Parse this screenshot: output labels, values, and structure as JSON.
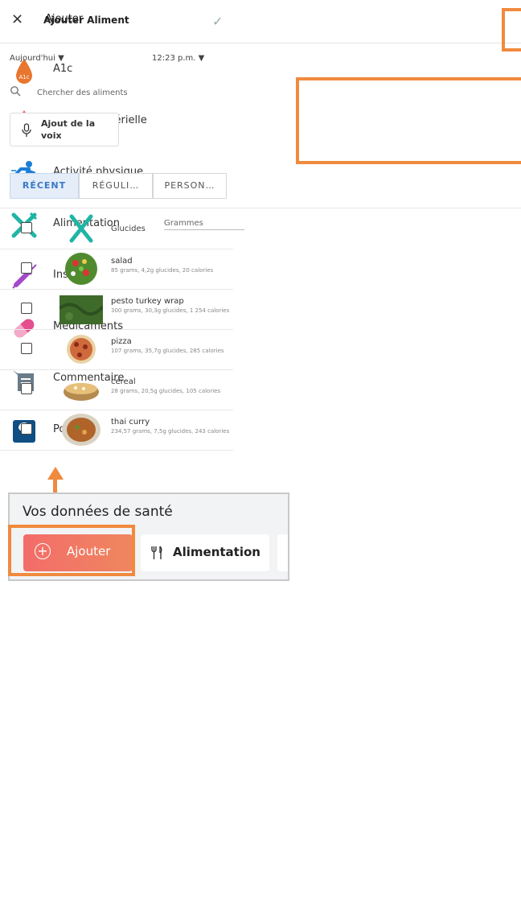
{
  "add_menu": {
    "title": "Ajouter",
    "close_icon": "×",
    "items": [
      {
        "label": "A1c",
        "icon": "a1c-drop-icon"
      },
      {
        "label": "Pression artérielle",
        "icon": "blood-pressure-drop-icon"
      },
      {
        "label": "Activité physique",
        "icon": "runner-icon"
      },
      {
        "label": "Alimentation",
        "icon": "fork-knife-icon"
      },
      {
        "label": "Insuline",
        "icon": "syringe-icon"
      },
      {
        "label": "Médicaments",
        "icon": "pill-icon"
      },
      {
        "label": "Commentaire",
        "icon": "comment-icon"
      },
      {
        "label": "Poids",
        "icon": "scale-icon"
      }
    ],
    "a1c_badge": "A1c"
  },
  "add_food": {
    "title": "Ajouter Aliment",
    "close_icon": "×",
    "confirm_icon": "✓",
    "date": "Aujourd'hui ▼",
    "time": "12:23 p.m. ▼",
    "search_placeholder": "Chercher des aliments",
    "voice_label": "Ajout de la voix",
    "tabs": [
      "RÉCENT",
      "RÉGULI…",
      "PERSON…"
    ],
    "carbs_label": "Glucides",
    "carbs_unit": "Grammes",
    "foods": [
      {
        "name": "salad",
        "detail": "85 grams, 4,2g glucides, 20 calories"
      },
      {
        "name": "pesto turkey wrap",
        "detail": "300 grams, 30,3g glucides, 1 254 calories"
      },
      {
        "name": "pizza",
        "detail": "107 grams, 35,7g glucides, 285 calories"
      },
      {
        "name": "cereal",
        "detail": "28 grams, 20,5g glucides, 105 calories"
      },
      {
        "name": "thai curry",
        "detail": "234,57 grams, 7,5g glucides, 243 calories"
      }
    ]
  },
  "health": {
    "title": "Vos données de santé",
    "add_label": "Ajouter",
    "add_icon": "+",
    "food_label": "Alimentation",
    "food_icon": "🍴"
  },
  "colors": {
    "highlight": "#f08a3e",
    "accent": "#3a78c8",
    "teal": "#1fb5a6",
    "drop": "#e9762f"
  }
}
